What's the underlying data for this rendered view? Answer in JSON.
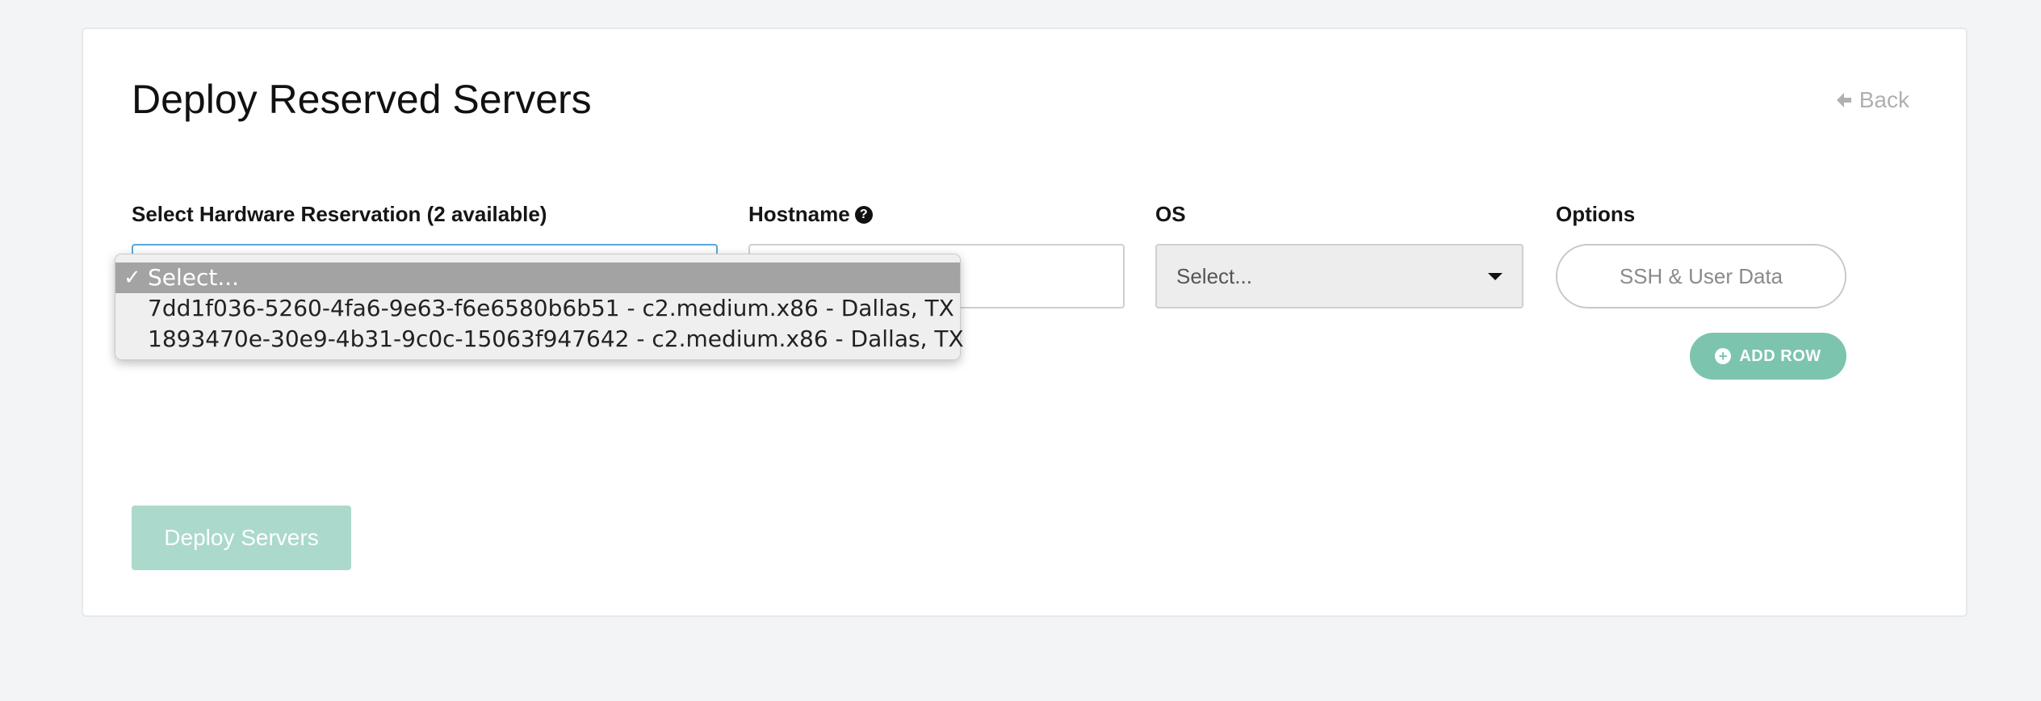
{
  "page": {
    "title": "Deploy Reserved Servers",
    "back_label": "Back"
  },
  "form": {
    "hardware_label": "Select Hardware Reservation (2 available)",
    "hostname_label": "Hostname",
    "os_label": "OS",
    "os_value": "Select...",
    "options_label": "Options",
    "ssh_button_label": "SSH & User Data",
    "add_row_label": "ADD ROW",
    "deploy_label": "Deploy Servers"
  },
  "dropdown": {
    "options": [
      {
        "label": "Select...",
        "selected": true
      },
      {
        "label": "7dd1f036-5260-4fa6-9e63-f6e6580b6b51 - c2.medium.x86 - Dallas, TX",
        "selected": false
      },
      {
        "label": "1893470e-30e9-4b31-9c0c-15063f947642 - c2.medium.x86 - Dallas, TX",
        "selected": false
      }
    ]
  },
  "colors": {
    "page_bg": "#f3f4f6",
    "accent_green": "#7cc4ae",
    "deploy_disabled": "#abd9cc",
    "focus_blue": "#5aa7d9",
    "dropdown_selected": "#a3a3a3"
  },
  "icons": {
    "back": "arrow-left-icon",
    "help": "question-circle-icon",
    "os_caret": "caret-down-icon",
    "add_row": "plus-circle-icon",
    "selected_option": "check-icon"
  }
}
